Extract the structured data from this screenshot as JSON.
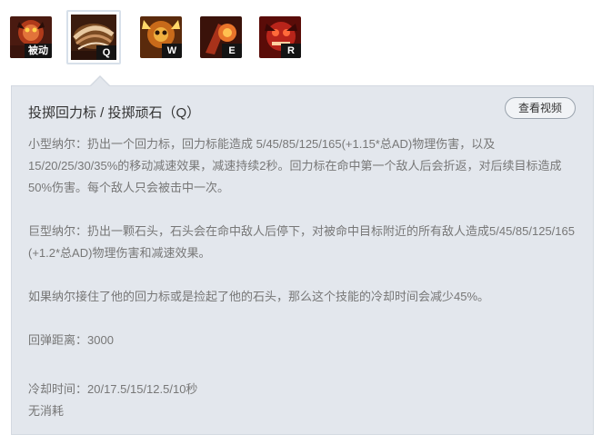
{
  "skills": [
    {
      "key_label": "被动",
      "icon": "nar-passive-icon",
      "color": "#b03a1a"
    },
    {
      "key_label": "Q",
      "icon": "boomerang-throw-icon",
      "color": "#7a4a22",
      "selected": true
    },
    {
      "key_label": "W",
      "icon": "hyper-icon",
      "color": "#c86a1a"
    },
    {
      "key_label": "E",
      "icon": "wallop-icon",
      "color": "#a8321a"
    },
    {
      "key_label": "R",
      "icon": "gnar-icon",
      "color": "#b8241a"
    }
  ],
  "panel": {
    "title": "投掷回力标 / 投掷顽石（Q）",
    "video_button": "查看视频",
    "paragraphs": {
      "p1": "小型纳尔：扔出一个回力标，回力标能造成 5/45/85/125/165(+1.15*总AD)物理伤害，以及15/20/25/30/35%的移动减速效果，减速持续2秒。回力标在命中第一个敌人后会折返，对后续目标造成50%伤害。每个敌人只会被击中一次。",
      "p2": "巨型纳尔：扔出一颗石头，石头会在命中敌人后停下，对被命中目标附近的所有敌人造成5/45/85/125/165 (+1.2*总AD)物理伤害和减速效果。",
      "p3": "如果纳尔接住了他的回力标或是捡起了他的石头，那么这个技能的冷却时间会减少45%。",
      "p4": "回弹距离：3000",
      "p5": "冷却时间：20/17.5/15/12.5/10秒",
      "p6": "无消耗"
    }
  }
}
